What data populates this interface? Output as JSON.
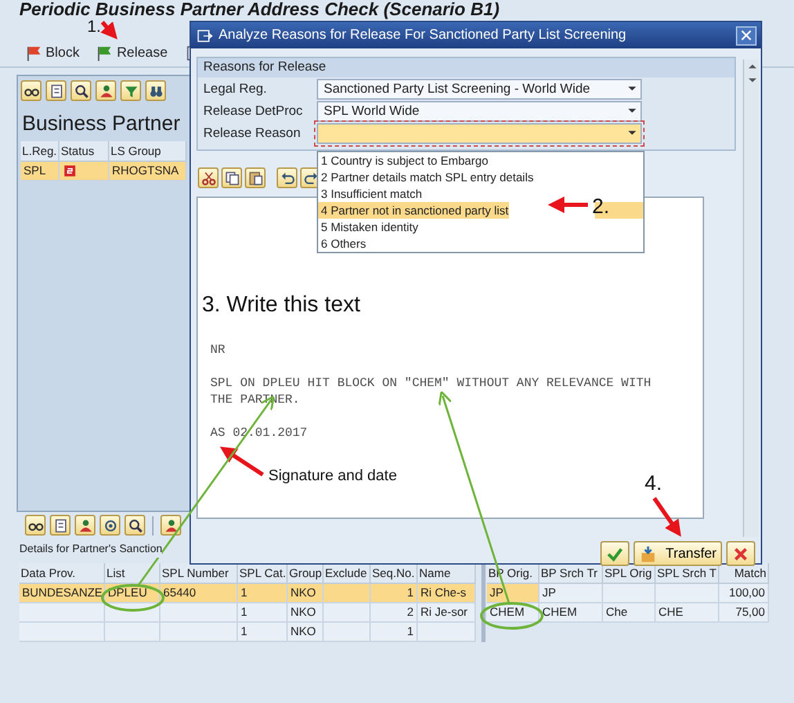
{
  "window": {
    "title": "Periodic Business Partner Address Check (Scenario B1)"
  },
  "toolbar": [
    {
      "kind": "block",
      "label": "Block"
    },
    {
      "kind": "release",
      "label": "Release"
    },
    {
      "kind": "other"
    }
  ],
  "business_partner": {
    "title": "Business Partner",
    "columns": [
      "L.Reg.",
      "Status",
      "LS Group"
    ],
    "rows": [
      {
        "selected": true,
        "blocked": true,
        "cells": [
          "SPL",
          null,
          "RHOGTSNA"
        ]
      }
    ]
  },
  "details": {
    "caption": "Details for Partner's Sanction",
    "columns": [
      "Data Prov.",
      "List",
      "SPL Number",
      "SPL Cat.",
      "Group",
      "Exclude",
      "Seq.No.",
      "Name"
    ],
    "rows": [
      {
        "selected": true,
        "cells": [
          "BUNDESANZE",
          "DPLEU",
          "65440",
          "1",
          "NKO",
          null,
          "1",
          "Ri Che-s"
        ]
      },
      {
        "selected": false,
        "cells": [
          null,
          null,
          null,
          "1",
          "NKO",
          null,
          "2",
          "Ri Je-sor"
        ]
      },
      {
        "selected": false,
        "cells": [
          null,
          null,
          null,
          "1",
          "NKO",
          null,
          "1",
          null
        ]
      }
    ],
    "match_columns": [
      "BP Orig.",
      "BP Srch Tr",
      "SPL Orig",
      "SPL Srch T",
      "Match"
    ],
    "match_rows": [
      {
        "selected": true,
        "cells": [
          "JP",
          "JP",
          null,
          null,
          "100,00"
        ]
      },
      {
        "selected": false,
        "cells": [
          "CHEM",
          "CHEM",
          "Che",
          "CHE",
          "75,00"
        ]
      }
    ]
  },
  "dialog": {
    "title": "Analyze Reasons for Release For Sanctioned Party List Screening",
    "group_title": "Reasons for Release",
    "fields": [
      {
        "label": "Legal Reg.",
        "value": "Sanctioned Party List Screening - World Wide",
        "focused": false
      },
      {
        "label": "Release DetProc",
        "value": "SPL World Wide",
        "focused": false
      },
      {
        "label": "Release Reason",
        "focused": true
      }
    ],
    "dropdown": [
      {
        "label": "1 Country is subject to Embargo",
        "selected": false
      },
      {
        "label": "2 Partner details match SPL entry details",
        "selected": false
      },
      {
        "label": "3 Insufficient match",
        "selected": false
      },
      {
        "label": "4 Partner not in sanctioned party list",
        "selected": true
      },
      {
        "label": "5 Mistaken identity",
        "selected": false
      },
      {
        "label": "6 Others",
        "selected": false
      }
    ],
    "editor_lines": [
      "NR",
      "SPL ON DPLEU HIT BLOCK ON \"CHEM\" WITHOUT ANY RELEVANCE WITH THE PARTNER.",
      "AS 02.01.2017"
    ],
    "buttons": [
      {
        "kind": "ok"
      },
      {
        "kind": "transfer",
        "label": "Transfer"
      },
      {
        "kind": "cancel"
      }
    ]
  },
  "annotations": [
    "1.",
    "2.",
    "3. Write this text",
    "Signature and date",
    "4."
  ]
}
